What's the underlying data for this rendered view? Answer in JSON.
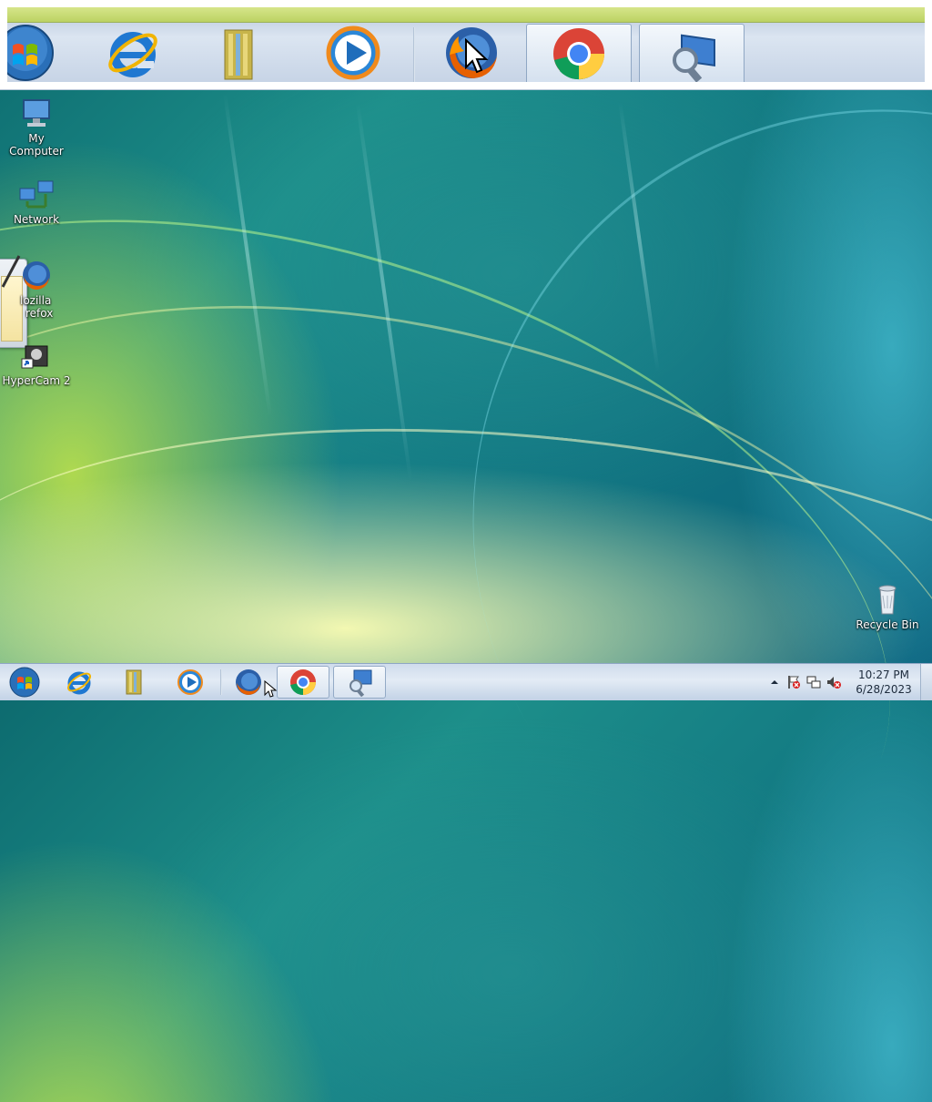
{
  "screen": {
    "title": "Windows 7 desktop with magnified taskbar"
  },
  "zoom_strip": {
    "buttons": [
      {
        "name": "start-orb",
        "icon": "windows-orb-icon"
      },
      {
        "name": "internet-explorer",
        "icon": "internet-explorer-icon"
      },
      {
        "name": "libraries",
        "icon": "libraries-icon"
      },
      {
        "name": "windows-media-player",
        "icon": "media-player-icon"
      },
      {
        "name": "firefox",
        "icon": "firefox-icon"
      },
      {
        "name": "chrome",
        "icon": "chrome-icon",
        "active": true
      },
      {
        "name": "magnifier",
        "icon": "magnifier-icon",
        "active": true
      }
    ]
  },
  "desktop": {
    "icons": [
      {
        "label": "My Computer",
        "icon": "computer-icon"
      },
      {
        "label": "Network",
        "icon": "network-icon"
      },
      {
        "label_line1": "Mozilla",
        "label_line2": "Firefox",
        "label_visible_line1": "lozilla",
        "label_visible_line2": "refox",
        "icon": "firefox-icon"
      },
      {
        "label": "HyperCam 2",
        "icon": "hypercam-icon"
      },
      {
        "label": "Recycle Bin",
        "icon": "recycle-bin-icon"
      }
    ]
  },
  "taskbar": {
    "clock_time": "10:27 PM",
    "clock_date": "6/28/2023",
    "tray_icons": [
      "show-hidden-icons-arrow",
      "action-center-flag-icon",
      "network-icon",
      "volume-muted-icon"
    ]
  },
  "colors": {
    "desktop_teal": "#137a83",
    "taskbar": "#cfdcec",
    "zoom_band": "#c7d9ff"
  }
}
